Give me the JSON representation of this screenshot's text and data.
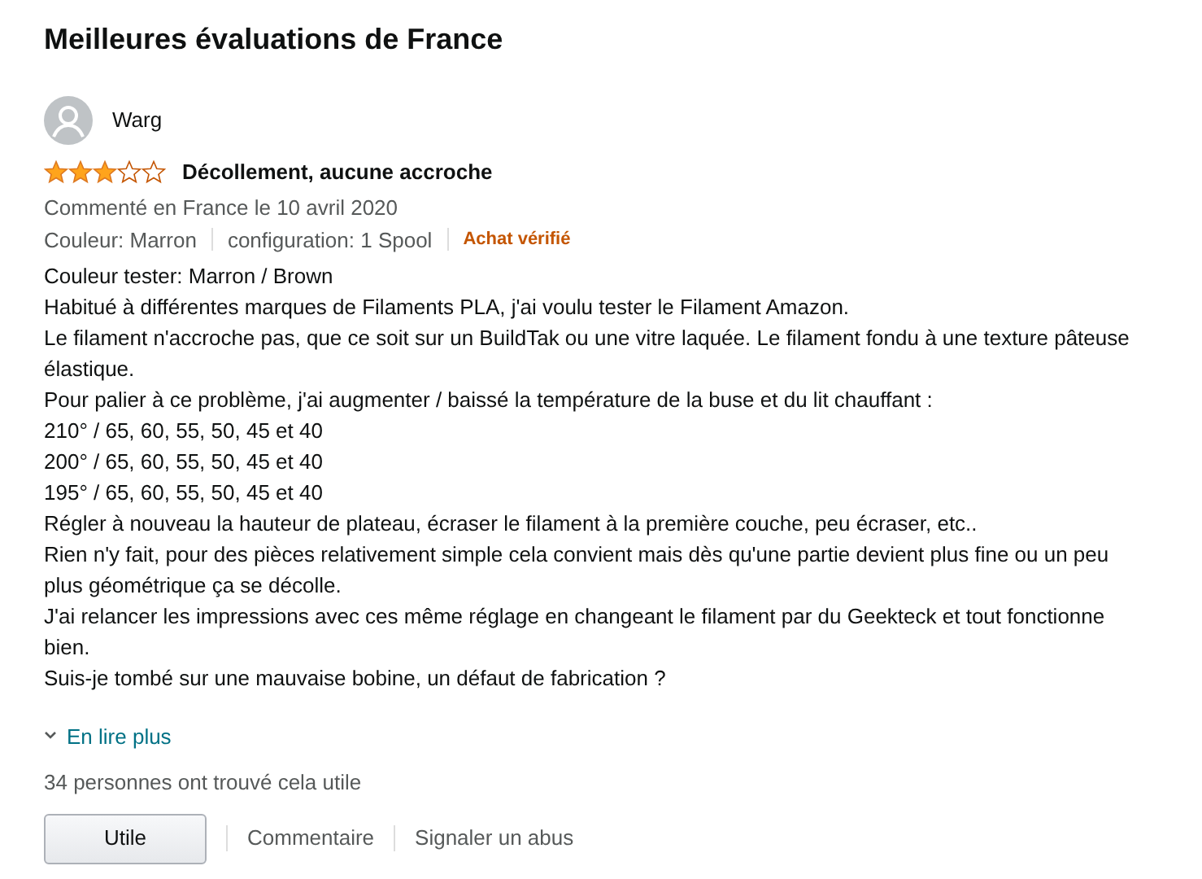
{
  "heading": "Meilleures évaluations de France",
  "review": {
    "author": "Warg",
    "stars": 3,
    "title": "Décollement, aucune accroche",
    "date": "Commenté en France le 10 avril 2020",
    "attributes": [
      "Couleur: Marron",
      "configuration: 1 Spool"
    ],
    "badge": "Achat vérifié",
    "paragraphs": [
      "Couleur tester: Marron / Brown",
      "Habitué à différentes marques de Filaments PLA, j'ai voulu tester le Filament Amazon.",
      "Le filament n'accroche pas, que ce soit sur un BuildTak ou une vitre laquée. Le filament fondu à une texture pâteuse élastique.",
      "Pour palier à ce problème, j'ai augmenter / baissé la température de la buse et du lit chauffant :",
      "210° / 65, 60, 55, 50, 45 et 40",
      "200° / 65, 60, 55, 50, 45 et 40",
      "195° / 65, 60, 55, 50, 45 et 40",
      "Régler à nouveau la hauteur de plateau, écraser le filament à la première couche, peu écraser, etc..",
      "Rien n'y fait, pour des pièces relativement simple cela convient mais dès qu'une partie devient plus fine ou un peu plus géométrique ça se décolle.",
      "J'ai relancer les impressions avec ces même réglage en changeant le filament par du Geekteck et tout fonctionne bien.",
      "Suis-je tombé sur une mauvaise bobine, un défaut de fabrication ?"
    ],
    "read_more": "En lire plus",
    "helpful_count": "34 personnes ont trouvé cela utile",
    "helpful_button": "Utile",
    "actions": [
      "Commentaire",
      "Signaler un abus"
    ]
  }
}
